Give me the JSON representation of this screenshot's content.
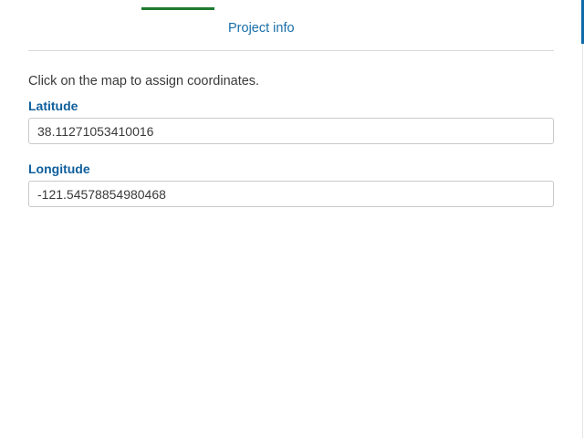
{
  "tab": {
    "label": "Project info"
  },
  "form": {
    "instruction": "Click on the map to assign coordinates.",
    "latitude": {
      "label": "Latitude",
      "value": "38.11271053410016"
    },
    "longitude": {
      "label": "Longitude",
      "value": "-121.54578854980468"
    }
  },
  "colors": {
    "accent_blue": "#0f6aa8",
    "label_blue": "#0f5f9c",
    "active_tab_green": "#1f7a2e"
  }
}
